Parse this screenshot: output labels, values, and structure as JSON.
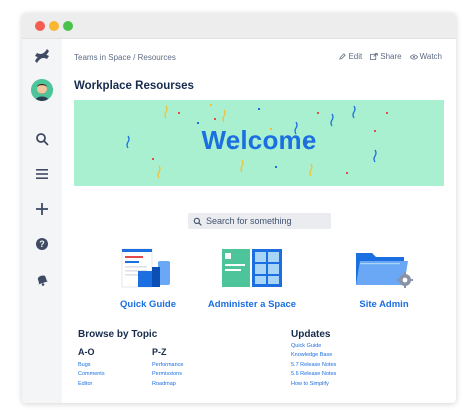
{
  "window": {
    "buttons": [
      "close",
      "minimize",
      "maximize"
    ]
  },
  "sidebar": {
    "items": [
      {
        "icon": "confluence-logo-icon"
      },
      {
        "icon": "user-avatar"
      },
      {
        "icon": "search-icon"
      },
      {
        "icon": "menu-icon"
      },
      {
        "icon": "plus-icon"
      },
      {
        "icon": "help-icon"
      },
      {
        "icon": "notification-icon"
      }
    ]
  },
  "header": {
    "breadcrumb": "Teams in Space / Resources",
    "actions": [
      {
        "label": "Edit",
        "icon": "pencil-icon"
      },
      {
        "label": "Share",
        "icon": "share-icon"
      },
      {
        "label": "Watch",
        "icon": "eye-icon"
      }
    ]
  },
  "page": {
    "title": "Workplace Resourses"
  },
  "banner": {
    "text": "Welcome"
  },
  "search": {
    "placeholder": "Search for something"
  },
  "cards": [
    {
      "label": "Quick Guide",
      "icon": "document-icon"
    },
    {
      "label": "Administer a Space",
      "icon": "dashboard-icon"
    },
    {
      "label": "Site Admin",
      "icon": "folder-settings-icon"
    }
  ],
  "browse": {
    "title": "Browse by Topic",
    "columns": [
      {
        "title": "A-O",
        "links": [
          "Bugs",
          "Comments",
          "Editor"
        ]
      },
      {
        "title": "P-Z",
        "links": [
          "Performance",
          "Permissions",
          "Roadmap"
        ]
      }
    ]
  },
  "updates": {
    "title": "Updates",
    "links": [
      "Quick Guide",
      "Knowledge Base",
      "5.7 Release Notes",
      "5.6 Release Notes",
      "How to Simplify"
    ]
  },
  "colors": {
    "accent": "#1C6FE0",
    "banner": "#A8F0D0",
    "text": "#172B4D",
    "sidebar": "#F4F5F7"
  }
}
